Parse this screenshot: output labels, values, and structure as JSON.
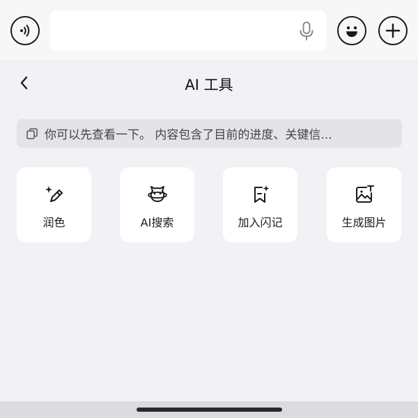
{
  "header": {
    "voice_icon": "voice-mode-icon",
    "input_value": "",
    "mic_icon": "microphone-icon",
    "emoji_icon": "emoji-icon",
    "plus_icon": "plus-icon"
  },
  "page": {
    "title": "AI 工具",
    "back_icon": "chevron-left-icon"
  },
  "quote": {
    "icon": "copy-icon",
    "text": "你可以先查看一下。 内容包含了目前的进度、关键信..."
  },
  "tools": [
    {
      "label": "润色",
      "icon": "magic-pen-icon"
    },
    {
      "label": "AI搜索",
      "icon": "ai-search-icon"
    },
    {
      "label": "加入闪记",
      "icon": "bookmark-sparkle-icon"
    },
    {
      "label": "生成图片",
      "icon": "image-generate-icon"
    }
  ]
}
